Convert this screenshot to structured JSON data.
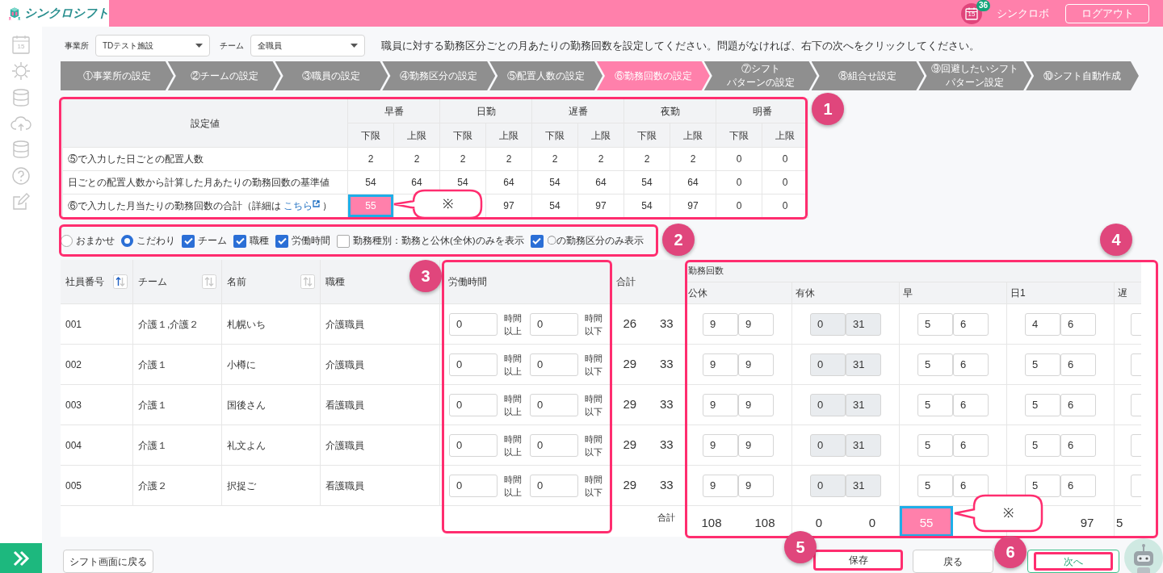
{
  "header": {
    "app_name": "シンクロシフト",
    "calendar_day": "15",
    "notification_count": "36",
    "user_name": "シンクロボ",
    "logout_label": "ログアウト"
  },
  "sidebar": {
    "calendar_day": "15"
  },
  "filters": [
    {
      "label": "事業所",
      "value": "TDテスト施設"
    },
    {
      "label": "チーム",
      "value": "全職員"
    }
  ],
  "instruction": "職員に対する勤務区分ごとの月あたりの勤務回数を設定してください。問題がなければ、右下の次へをクリックしてください。",
  "steps": [
    {
      "lines": [
        "①事業所の設定"
      ],
      "selected": false
    },
    {
      "lines": [
        "②チームの設定"
      ],
      "selected": false
    },
    {
      "lines": [
        "③職員の設定"
      ],
      "selected": false
    },
    {
      "lines": [
        "④勤務区分の設定"
      ],
      "selected": false
    },
    {
      "lines": [
        "⑤配置人数の設定"
      ],
      "selected": false
    },
    {
      "lines": [
        "⑥勤務回数の設定"
      ],
      "selected": true
    },
    {
      "lines": [
        "⑦シフト",
        "パターンの設定"
      ],
      "selected": false
    },
    {
      "lines": [
        "⑧組合せ設定"
      ],
      "selected": false
    },
    {
      "lines": [
        "⑨回避したいシフト",
        "パターン設定"
      ],
      "selected": false
    },
    {
      "lines": [
        "⑩シフト自動作成"
      ],
      "selected": false
    }
  ],
  "summary_table": {
    "badge": "1",
    "corner": "設定値",
    "callout": "※",
    "groups": [
      {
        "name": "早番",
        "lower": "下限",
        "upper": "上限"
      },
      {
        "name": "日勤",
        "lower": "下限",
        "upper": "上限"
      },
      {
        "name": "遅番",
        "lower": "下限",
        "upper": "上限"
      },
      {
        "name": "夜勤",
        "lower": "下限",
        "upper": "上限"
      },
      {
        "name": "明番",
        "lower": "下限",
        "upper": "上限"
      }
    ],
    "rows": [
      {
        "label": "⑤で入力した日ごとの配置人数",
        "cells": [
          {
            "text": "2",
            "highlighted": false
          },
          {
            "text": "2",
            "highlighted": false
          },
          {
            "text": "2",
            "highlighted": false
          },
          {
            "text": "2",
            "highlighted": false
          },
          {
            "text": "2",
            "highlighted": false
          },
          {
            "text": "2",
            "highlighted": false
          },
          {
            "text": "2",
            "highlighted": false
          },
          {
            "text": "2",
            "highlighted": false
          },
          {
            "text": "0",
            "highlighted": false
          },
          {
            "text": "0",
            "highlighted": false
          }
        ]
      },
      {
        "label": "日ごとの配置人数から計算した月あたりの勤務回数の基準値",
        "cells": [
          {
            "text": "54",
            "highlighted": false
          },
          {
            "text": "64",
            "highlighted": false
          },
          {
            "text": "54",
            "highlighted": false
          },
          {
            "text": "64",
            "highlighted": false
          },
          {
            "text": "54",
            "highlighted": false
          },
          {
            "text": "64",
            "highlighted": false
          },
          {
            "text": "54",
            "highlighted": false
          },
          {
            "text": "64",
            "highlighted": false
          },
          {
            "text": "0",
            "highlighted": false
          },
          {
            "text": "0",
            "highlighted": false
          }
        ]
      },
      {
        "label": "⑥で入力した月当たりの勤務回数の合計（詳細は",
        "link": "こちら",
        "label_end": "）",
        "cells": [
          {
            "text": "55",
            "highlighted": true
          },
          null,
          null,
          {
            "text": "97",
            "highlighted": false
          },
          {
            "text": "54",
            "highlighted": false
          },
          {
            "text": "97",
            "highlighted": false
          },
          {
            "text": "54",
            "highlighted": false
          },
          {
            "text": "97",
            "highlighted": false
          },
          {
            "text": "0",
            "highlighted": false
          },
          {
            "text": "0",
            "highlighted": false
          }
        ]
      }
    ]
  },
  "options": {
    "badge": "2",
    "items": [
      {
        "kind": "radio",
        "label": "おまかせ",
        "checked": false
      },
      {
        "kind": "radio",
        "label": "こだわり",
        "checked": true
      },
      {
        "kind": "checkbox",
        "label": "チーム",
        "checked": true
      },
      {
        "kind": "checkbox",
        "label": "職種",
        "checked": true
      },
      {
        "kind": "checkbox",
        "label": "労働時間",
        "checked": true
      },
      {
        "kind": "checkbox",
        "label": "勤務種別：勤務と公休(全休)のみを表示",
        "checked": false
      },
      {
        "kind": "checkbox",
        "label": "〇の勤務区分のみ表示",
        "checked": true
      }
    ]
  },
  "staff_table": {
    "hours_badge": "3",
    "counts_badge": "4",
    "callout": "※",
    "columns": [
      {
        "label": "社員番号",
        "sort_active": true
      },
      {
        "label": "チーム",
        "sort_active": false
      },
      {
        "label": "名前",
        "sort_active": false
      },
      {
        "label": "職種"
      }
    ],
    "hours_label": "労働時間",
    "total_label": "合計",
    "counts_label": "勤務回数",
    "count_columns": [
      "公休",
      "有休",
      "早",
      "日1",
      "遅"
    ],
    "rows": [
      {
        "id": "001",
        "team": "介護１,介護２",
        "name": "札幌いち",
        "job": "介護職員",
        "hours_min": "0",
        "min_unit": [
          "時間",
          "以上"
        ],
        "hours_max": "0",
        "max_unit": [
          "時間",
          "以下"
        ],
        "total_min": "26",
        "total_max": "33",
        "counts": [
          {
            "min": "9",
            "max": "9",
            "disabled": false
          },
          {
            "min": "0",
            "max": "31",
            "disabled": true
          },
          {
            "min": "5",
            "max": "6",
            "disabled": false
          },
          {
            "min": "4",
            "max": "6",
            "disabled": false
          }
        ]
      },
      {
        "id": "002",
        "team": "介護１",
        "name": "小樽に",
        "job": "介護職員",
        "hours_min": "0",
        "min_unit": [
          "時間",
          "以上"
        ],
        "hours_max": "0",
        "max_unit": [
          "時間",
          "以下"
        ],
        "total_min": "29",
        "total_max": "33",
        "counts": [
          {
            "min": "9",
            "max": "9",
            "disabled": false
          },
          {
            "min": "0",
            "max": "31",
            "disabled": true
          },
          {
            "min": "5",
            "max": "6",
            "disabled": false
          },
          {
            "min": "5",
            "max": "6",
            "disabled": false
          }
        ]
      },
      {
        "id": "003",
        "team": "介護１",
        "name": "国後さん",
        "job": "看護職員",
        "hours_min": "0",
        "min_unit": [
          "時間",
          "以上"
        ],
        "hours_max": "0",
        "max_unit": [
          "時間",
          "以下"
        ],
        "total_min": "29",
        "total_max": "33",
        "counts": [
          {
            "min": "9",
            "max": "9",
            "disabled": false
          },
          {
            "min": "0",
            "max": "31",
            "disabled": true
          },
          {
            "min": "5",
            "max": "6",
            "disabled": false
          },
          {
            "min": "5",
            "max": "6",
            "disabled": false
          }
        ]
      },
      {
        "id": "004",
        "team": "介護１",
        "name": "礼文よん",
        "job": "介護職員",
        "hours_min": "0",
        "min_unit": [
          "時間",
          "以上"
        ],
        "hours_max": "0",
        "max_unit": [
          "時間",
          "以下"
        ],
        "total_min": "29",
        "total_max": "33",
        "counts": [
          {
            "min": "9",
            "max": "9",
            "disabled": false
          },
          {
            "min": "0",
            "max": "31",
            "disabled": true
          },
          {
            "min": "5",
            "max": "6",
            "disabled": false
          },
          {
            "min": "5",
            "max": "6",
            "disabled": false
          }
        ]
      },
      {
        "id": "005",
        "team": "介護２",
        "name": "択捉ご",
        "job": "看護職員",
        "hours_min": "0",
        "min_unit": [
          "時間",
          "以上"
        ],
        "hours_max": "0",
        "max_unit": [
          "時間",
          "以下"
        ],
        "total_min": "29",
        "total_max": "33",
        "counts": [
          {
            "min": "9",
            "max": "9",
            "disabled": false
          },
          {
            "min": "0",
            "max": "31",
            "disabled": true
          },
          {
            "min": "5",
            "max": "6",
            "disabled": false
          },
          {
            "min": "5",
            "max": "6",
            "disabled": false
          }
        ]
      }
    ],
    "footer_label": "合計",
    "footer_totals": [
      {
        "lower": "108",
        "upper": "108",
        "highlighted": false
      },
      {
        "lower": "0",
        "upper": "0",
        "highlighted": false
      },
      {
        "lower": "55",
        "highlighted": true
      },
      {
        "upper": "97",
        "highlighted": false
      },
      {
        "lower": "5",
        "highlighted": false
      }
    ]
  },
  "buttons": {
    "back": "シフト画面に戻る",
    "save": "保存",
    "return": "戻る",
    "next": "次へ",
    "save_badge": "5",
    "next_badge": "6"
  }
}
